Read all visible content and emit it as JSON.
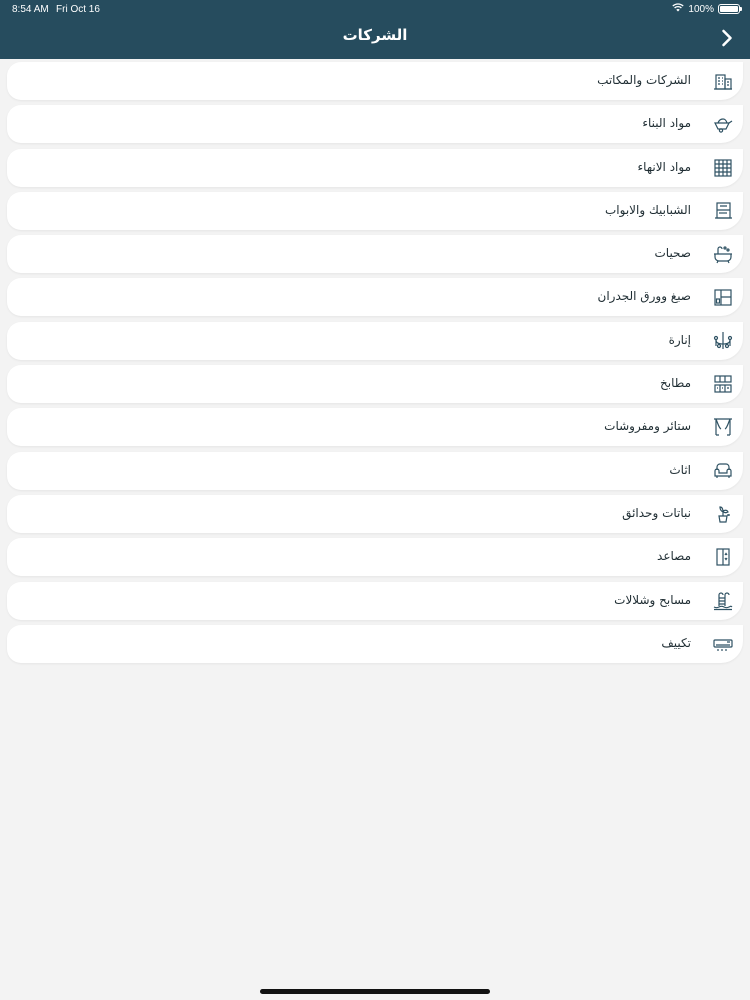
{
  "status_bar": {
    "time": "8:54 AM",
    "date": "Fri Oct 16",
    "battery_text": "100%",
    "battery_level": 1.0
  },
  "header": {
    "title": "الشركات",
    "back_icon": "chevron-right-icon"
  },
  "colors": {
    "header_bg": "#264c5e",
    "page_bg": "#f3f3f3",
    "row_bg": "#ffffff",
    "icon": "#2f5263"
  },
  "categories": [
    {
      "label": "الشركات والمكاتب",
      "icon": "office-building-icon"
    },
    {
      "label": "مواد البناء",
      "icon": "wheelbarrow-icon"
    },
    {
      "label": "مواد الانهاء",
      "icon": "tiles-icon"
    },
    {
      "label": "الشبابيك والابواب",
      "icon": "window-icon"
    },
    {
      "label": "صحيات",
      "icon": "bathtub-icon"
    },
    {
      "label": "صبغ وورق الجدران",
      "icon": "wallpaper-icon"
    },
    {
      "label": "إنارة",
      "icon": "chandelier-icon"
    },
    {
      "label": "مطابخ",
      "icon": "kitchen-icon"
    },
    {
      "label": "ستائر ومفروشات",
      "icon": "curtains-icon"
    },
    {
      "label": "اثاث",
      "icon": "armchair-icon"
    },
    {
      "label": "نباتات وحدائق",
      "icon": "plant-icon"
    },
    {
      "label": "مصاعد",
      "icon": "elevator-icon"
    },
    {
      "label": "مسابح وشلالات",
      "icon": "pool-ladder-icon"
    },
    {
      "label": "تكييف",
      "icon": "air-conditioner-icon"
    }
  ]
}
